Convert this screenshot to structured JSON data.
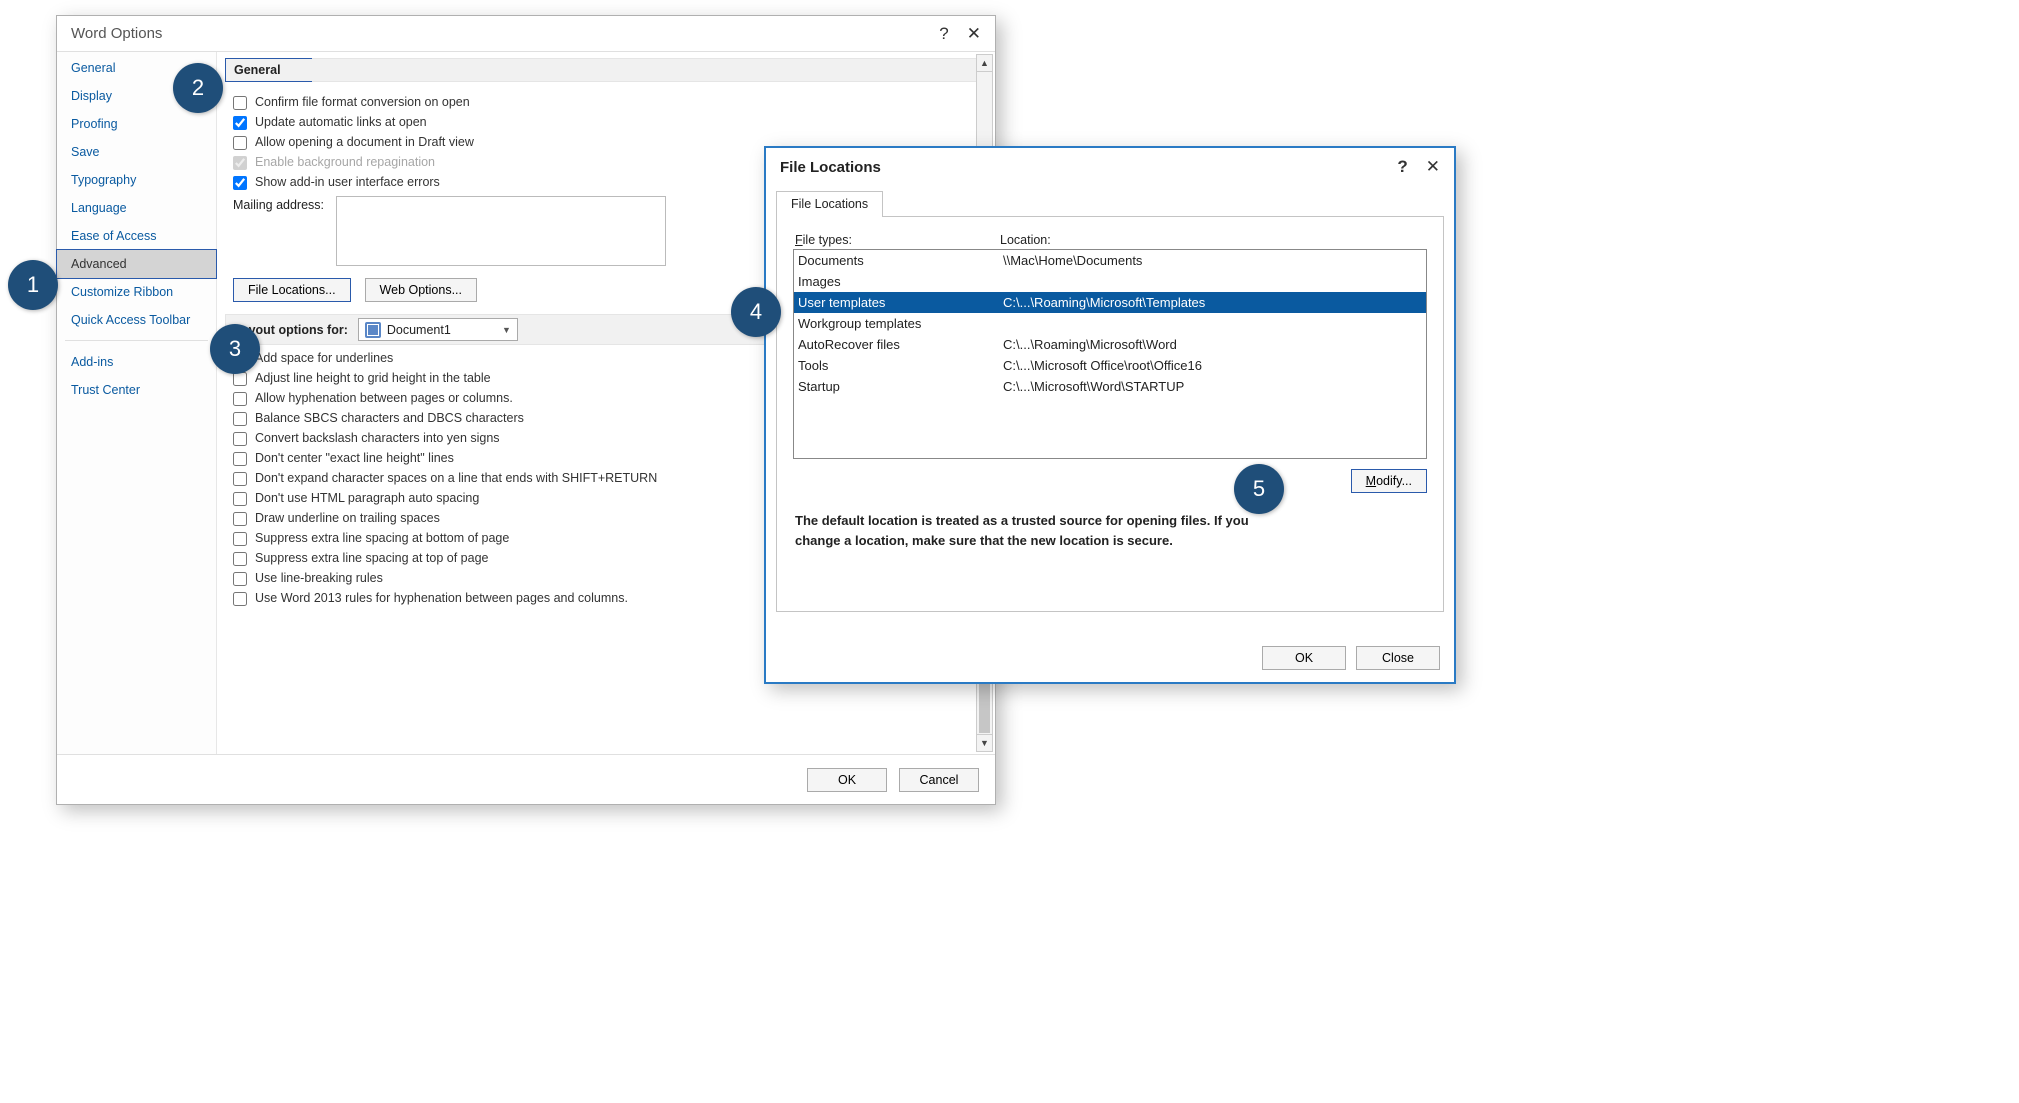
{
  "wordopts": {
    "title": "Word Options",
    "sidebar": {
      "items": [
        "General",
        "Display",
        "Proofing",
        "Save",
        "Typography",
        "Language",
        "Ease of Access",
        "Advanced",
        "Customize Ribbon",
        "Quick Access Toolbar",
        "Add-ins",
        "Trust Center"
      ],
      "selected_index": 7
    },
    "general_heading": "General",
    "chk_confirm": "Confirm file format conversion on open",
    "chk_update": "Update automatic links at open",
    "chk_draft": "Allow opening a document in Draft view",
    "chk_bg": "Enable background repagination",
    "chk_addin": "Show add-in user interface errors",
    "lbl_mail": "Mailing address:",
    "btn_fileloc": "File Locations...",
    "btn_webopts": "Web Options...",
    "layout_heading": "Layout options for:",
    "layout_doc": "Document1",
    "layout_opts": [
      "Add space for underlines",
      "Adjust line height to grid height in the table",
      "Allow hyphenation between pages or columns.",
      "Balance SBCS characters and DBCS characters",
      "Convert backslash characters into yen signs",
      "Don't center \"exact line height\" lines",
      "Don't expand character spaces on a line that ends with SHIFT+RETURN",
      "Don't use HTML paragraph auto spacing",
      "Draw underline on trailing spaces",
      "Suppress extra line spacing at bottom of page",
      "Suppress extra line spacing at top of page",
      "Use line-breaking rules",
      "Use Word 2013 rules for hyphenation between pages and columns."
    ],
    "btn_ok": "OK",
    "btn_cancel": "Cancel"
  },
  "floc": {
    "title": "File Locations",
    "tab": "File Locations",
    "col1": "File types:",
    "col2": "Location:",
    "rows": [
      {
        "type": "Documents",
        "loc": "\\\\Mac\\Home\\Documents"
      },
      {
        "type": "Images",
        "loc": ""
      },
      {
        "type": "User templates",
        "loc": "C:\\...\\Roaming\\Microsoft\\Templates"
      },
      {
        "type": "Workgroup templates",
        "loc": ""
      },
      {
        "type": "AutoRecover files",
        "loc": "C:\\...\\Roaming\\Microsoft\\Word"
      },
      {
        "type": "Tools",
        "loc": "C:\\...\\Microsoft Office\\root\\Office16"
      },
      {
        "type": "Startup",
        "loc": "C:\\...\\Microsoft\\Word\\STARTUP"
      }
    ],
    "selected_index": 2,
    "btn_modify": "Modify...",
    "note": "The default location is treated as a trusted source for opening files. If you change a location, make sure that the new location is secure.",
    "btn_ok": "OK",
    "btn_close": "Close"
  },
  "badges": [
    "1",
    "2",
    "3",
    "4",
    "5"
  ]
}
